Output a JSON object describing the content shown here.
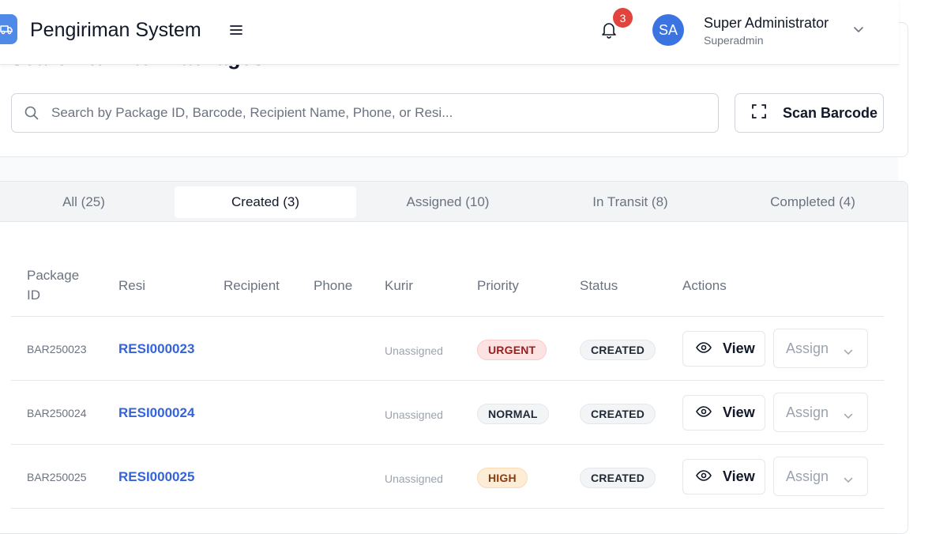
{
  "header": {
    "app_title": "Pengiriman System",
    "notification_count": "3",
    "user": {
      "initials": "SA",
      "name": "Super Administrator",
      "role": "Superadmin"
    }
  },
  "search": {
    "section_title": "Search & Filter Packages",
    "placeholder": "Search by Package ID, Barcode, Recipient Name, Phone, or Resi...",
    "scan_label": "Scan Barcode"
  },
  "tabs": [
    {
      "label": "All (25)",
      "active": false
    },
    {
      "label": "Created (3)",
      "active": true
    },
    {
      "label": "Assigned (10)",
      "active": false
    },
    {
      "label": "In Transit (8)",
      "active": false
    },
    {
      "label": "Completed (4)",
      "active": false
    }
  ],
  "table": {
    "headers": {
      "package_id": "Package ID",
      "resi": "Resi",
      "recipient": "Recipient",
      "phone": "Phone",
      "kurir": "Kurir",
      "priority": "Priority",
      "status": "Status",
      "actions": "Actions"
    },
    "rows": [
      {
        "package_id": "BAR250023",
        "resi": "RESI000023",
        "recipient": "",
        "phone": "",
        "kurir": "Unassigned",
        "priority": "URGENT",
        "status": "CREATED",
        "view_label": "View",
        "assign_placeholder": "Assign"
      },
      {
        "package_id": "BAR250024",
        "resi": "RESI000024",
        "recipient": "",
        "phone": "",
        "kurir": "Unassigned",
        "priority": "NORMAL",
        "status": "CREATED",
        "view_label": "View",
        "assign_placeholder": "Assign"
      },
      {
        "package_id": "BAR250025",
        "resi": "RESI000025",
        "recipient": "",
        "phone": "",
        "kurir": "Unassigned",
        "priority": "HIGH",
        "status": "CREATED",
        "view_label": "View",
        "assign_placeholder": "Assign"
      }
    ]
  },
  "colors": {
    "accent": "#3b74e0",
    "link": "#3563d8",
    "badge_notification": "#e0443c",
    "priority_urgent_bg": "#fde2e2",
    "priority_high_bg": "#fdecd6"
  },
  "icons": {
    "logo": "truck-icon",
    "menu": "hamburger-menu-icon",
    "notifications": "bell-icon",
    "search": "search-icon",
    "scan": "scan-frame-icon",
    "view": "eye-icon",
    "dropdown": "chevron-down-icon"
  }
}
